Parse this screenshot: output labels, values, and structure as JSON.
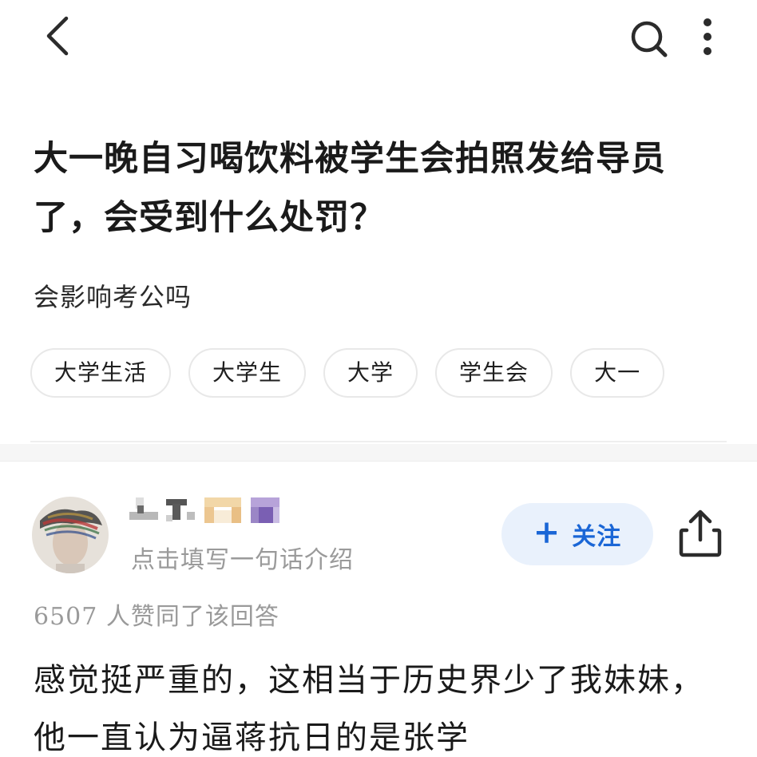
{
  "topbar": {
    "back_icon": "chevron-left-icon",
    "search_icon": "search-icon",
    "more_icon": "more-vertical-icon"
  },
  "question": {
    "title": "大一晚自习喝饮料被学生会拍照发给导员了，会受到什么处罚？",
    "description": "会影响考公吗",
    "tags": [
      "大学生活",
      "大学生",
      "大学",
      "学生会",
      "大一"
    ]
  },
  "answer": {
    "author": {
      "name": "",
      "intro": "点击填写一句话介绍",
      "avatar": "avatar-image"
    },
    "follow_label": "关注",
    "follow_icon": "plus-icon",
    "share_icon": "share-icon",
    "upvote_count": "6507",
    "upvote_text": "人赞同了该回答",
    "body": "感觉挺严重的，这相当于历史界少了我妹妹，他一直认为逼蒋抗日的是张学"
  },
  "colors": {
    "accent": "#1a66d6",
    "follow_bg": "#e9f1fc",
    "muted_text": "#9a9a9a",
    "divider": "#f6f6f6"
  }
}
